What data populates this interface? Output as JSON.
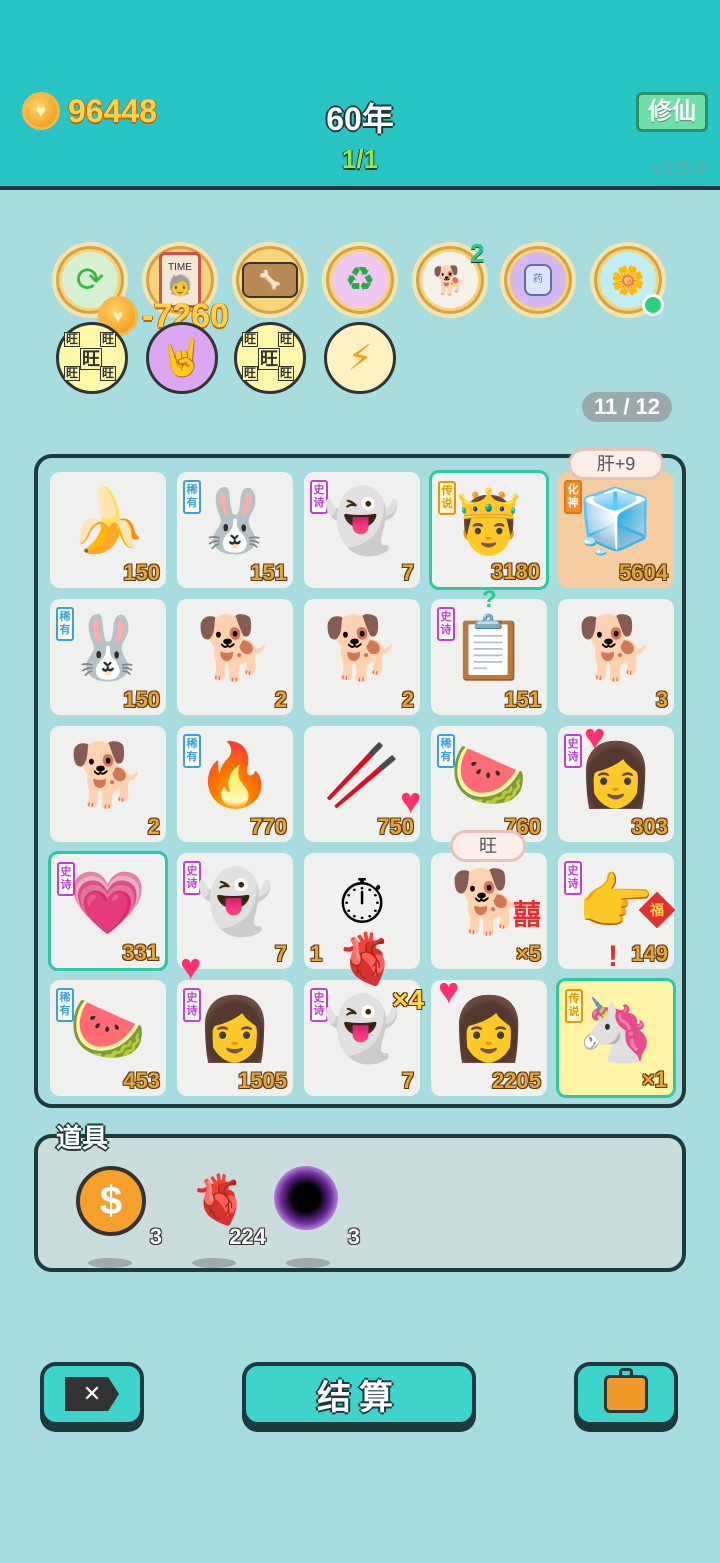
{
  "header": {
    "coins": "96448",
    "year": "60年",
    "stage": "1/1",
    "cultivate_label": "修仙",
    "version": "v3.0.9",
    "coin_delta": "-7260"
  },
  "relics": {
    "top_row": [
      {
        "icon": "refresh-icon",
        "glyph": "🔄"
      },
      {
        "icon": "time-card-icon",
        "glyph": "⏰"
      },
      {
        "icon": "dog-bowl-icon",
        "glyph": "🦴"
      },
      {
        "icon": "recycle-icon",
        "glyph": "♻"
      },
      {
        "icon": "dog-with-sunglasses-icon",
        "glyph": "🐕",
        "badge": "2"
      },
      {
        "icon": "medicine-jar-icon",
        "glyph": "🫙"
      },
      {
        "icon": "potted-flower-icon",
        "glyph": "🌼"
      }
    ],
    "bottom_row": [
      {
        "icon": "wang-charm-icon",
        "glyph": "旺"
      },
      {
        "icon": "rock-hand-icon",
        "glyph": "🤘"
      },
      {
        "icon": "wang-charm-icon",
        "glyph": "旺"
      },
      {
        "icon": "lightning-icon",
        "glyph": "⚡"
      }
    ]
  },
  "counter": "11 / 12",
  "board": {
    "cells": [
      {
        "glyph": "🍌",
        "tag": "",
        "tag_color": "",
        "num": "150"
      },
      {
        "glyph": "🐰",
        "tag": "稀有",
        "tag_color": "blue",
        "num": "151"
      },
      {
        "glyph": "👻",
        "tag": "史诗",
        "tag_color": "purple",
        "num": "7"
      },
      {
        "glyph": "🤴",
        "tag": "传说",
        "tag_color": "gold",
        "num": "3180"
      },
      {
        "glyph": "🧊",
        "tag": "化神",
        "tag_color": "orange",
        "num": "5604"
      },
      {
        "glyph": "🐰",
        "tag": "稀有",
        "tag_color": "blue",
        "num": "150"
      },
      {
        "glyph": "🐕",
        "tag": "",
        "tag_color": "",
        "num": "2"
      },
      {
        "glyph": "🐕",
        "tag": "",
        "tag_color": "",
        "num": "2"
      },
      {
        "glyph": "📋",
        "tag": "史诗",
        "tag_color": "purple",
        "num": "151"
      },
      {
        "glyph": "🐕",
        "tag": "",
        "tag_color": "",
        "num": "3"
      },
      {
        "glyph": "🐕",
        "tag": "",
        "tag_color": "",
        "num": "2"
      },
      {
        "glyph": "🔥",
        "tag": "稀有",
        "tag_color": "blue",
        "num": "770"
      },
      {
        "glyph": "🥢",
        "tag": "",
        "tag_color": "",
        "num": "750"
      },
      {
        "glyph": "🍉",
        "tag": "稀有",
        "tag_color": "blue",
        "num": "760"
      },
      {
        "glyph": "👩",
        "tag": "史诗",
        "tag_color": "purple",
        "num": "303"
      },
      {
        "glyph": "💗",
        "tag": "史诗",
        "tag_color": "purple",
        "num": "331"
      },
      {
        "glyph": "👻",
        "tag": "史诗",
        "tag_color": "purple",
        "num": "7"
      },
      {
        "glyph": "⏱",
        "tag": "",
        "tag_color": "",
        "num": "1"
      },
      {
        "glyph": "🐕",
        "tag": "",
        "tag_color": "",
        "num": "×5"
      },
      {
        "glyph": "👉",
        "tag": "史诗",
        "tag_color": "purple",
        "num": "149"
      },
      {
        "glyph": "🍉",
        "tag": "稀有",
        "tag_color": "blue",
        "num": "453"
      },
      {
        "glyph": "👩",
        "tag": "史诗",
        "tag_color": "purple",
        "num": "1505"
      },
      {
        "glyph": "👻",
        "tag": "史诗",
        "tag_color": "purple",
        "num": "7"
      },
      {
        "glyph": "👩",
        "tag": "",
        "tag_color": "",
        "num": "2205"
      },
      {
        "glyph": "🦄",
        "tag": "传说",
        "tag_color": "gold",
        "num": "×1"
      }
    ],
    "bubble_liver": "肝+9",
    "bubble_wang": "旺",
    "combo": "×4",
    "double_happiness": "囍",
    "fu": "福"
  },
  "props": {
    "label": "道具",
    "items": [
      {
        "icon": "dollar-coin-icon",
        "glyph": "$",
        "count": "3"
      },
      {
        "icon": "liver-icon",
        "glyph": "🫀",
        "count": "224"
      },
      {
        "icon": "black-hole-icon",
        "glyph": "●",
        "count": "3"
      }
    ]
  },
  "actions": {
    "settle_label": "结算",
    "close_label": "✕"
  }
}
